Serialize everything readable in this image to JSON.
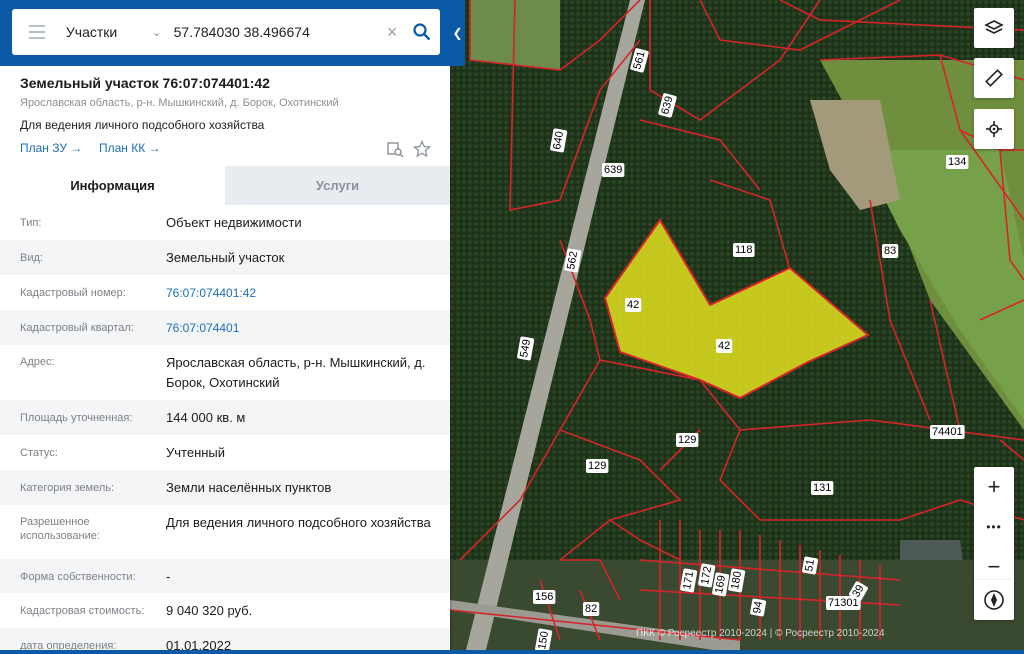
{
  "search": {
    "type": "Участки",
    "value": "57.784030 38.496674"
  },
  "object": {
    "title": "Земельный участок 76:07:074401:42",
    "address": "Ярославская область, р-н. Мышкинский, д. Борок, Охотинский",
    "purpose": "Для ведения личного подсобного хозяйства",
    "links": [
      "План ЗУ →",
      "План КК →"
    ]
  },
  "tabs": [
    {
      "label": "Информация",
      "active": true
    },
    {
      "label": "Услуги",
      "active": false
    }
  ],
  "info": [
    {
      "key": "Тип:",
      "value": "Объект недвижимости"
    },
    {
      "key": "Вид:",
      "value": "Земельный участок"
    },
    {
      "key": "Кадастровый номер:",
      "value": "76:07:074401:42",
      "link": true
    },
    {
      "key": "Кадастровый квартал:",
      "value": "76:07:074401",
      "link": true
    },
    {
      "key": "Адрес:",
      "value": "Ярославская область, р-н. Мышкинский, д. Борок, Охотинский"
    },
    {
      "key": "Площадь уточненная:",
      "value": "144 000 кв. м"
    },
    {
      "key": "Статус:",
      "value": "Учтенный"
    },
    {
      "key": "Категория земель:",
      "value": "Земли населённых пунктов"
    },
    {
      "key": "Разрешенное использование:",
      "value": "Для ведения личного подсобного хозяйства"
    },
    {
      "key": "Форма собственности:",
      "value": "-"
    },
    {
      "key": "Кадастровая стоимость:",
      "value": "9 040 320 руб."
    },
    {
      "key": "дата определения:",
      "value": "01.01.2022"
    }
  ],
  "map": {
    "labels": [
      "561",
      "639",
      "640",
      "639",
      "562",
      "549",
      "118",
      "42",
      "42",
      "83",
      "134",
      "129",
      "129",
      "131",
      "74401",
      "156",
      "82",
      "171",
      "172",
      "169",
      "180",
      "51",
      "94",
      "71301",
      "39",
      "150"
    ],
    "copyright": "ПКК © Росреестр 2010-2024 | © Росреестр 2010-2024"
  },
  "controls": {
    "zoom_in": "+",
    "more": "•••",
    "zoom_out": "−"
  }
}
